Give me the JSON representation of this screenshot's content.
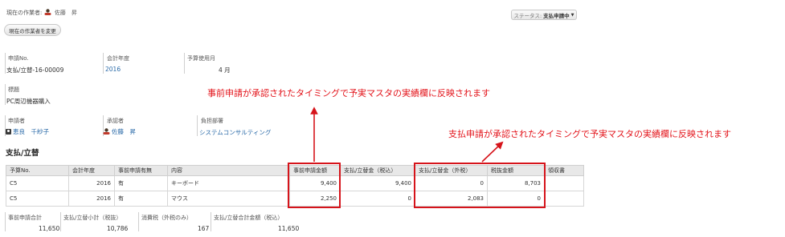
{
  "header": {
    "current_worker_label": "現在の作業者:",
    "current_worker_name": "佐藤　昇",
    "change_worker_button": "現在の作業者を変更",
    "status_label": "ステータス:",
    "status_value": "支払申請中",
    "status_dropdown_icon": "chevron-down-icon"
  },
  "fields": {
    "application_no_label": "申請No.",
    "application_no_value": "支払/立替-16-00009",
    "fiscal_year_label": "会計年度",
    "fiscal_year_value": "2016",
    "budget_month_label": "予算使用月",
    "budget_month_value": "4 月",
    "subject_label": "標題",
    "subject_value": "PC周辺機器購入",
    "applicant_label": "申請者",
    "applicant_value": "恵良　千紗子",
    "approver_label": "承認者",
    "approver_value": "佐藤　昇",
    "department_label": "負担部署",
    "department_value": "システムコンサルティング"
  },
  "section": {
    "title": "支払/立替"
  },
  "table": {
    "headers": [
      "予算No.",
      "会計年度",
      "事前申請有無",
      "内容",
      "事前申請金額",
      "支払/立替金（税込）",
      "支払/立替金（外税）",
      "税抜金額",
      "領収書"
    ],
    "rows": [
      [
        "C5",
        "2016",
        "有",
        "キーボード",
        "9,400",
        "9,400",
        "0",
        "8,703",
        ""
      ],
      [
        "C5",
        "2016",
        "有",
        "マウス",
        "2,250",
        "0",
        "2,083",
        "0",
        ""
      ]
    ]
  },
  "totals": {
    "pre_total_label": "事前申請合計",
    "pre_total_value": "11,650",
    "subtotal_label": "支払/立替小計（税抜）",
    "subtotal_value": "10,786",
    "tax_label": "消費税（外税のみ）",
    "tax_value": "167",
    "grand_total_label": "支払/立替合計金額（税込）",
    "grand_total_value": "11,650"
  },
  "annotations": {
    "pre_application": "事前申請が承認されたタイミングで予実マスタの実績欄に反映されます",
    "payment_application": "支払申請が承認されたタイミングで予実マスタの実績欄に反映されます",
    "color": "#e3141b"
  },
  "colors": {
    "link": "#2a6aa8",
    "highlight_box": "#d6141b",
    "table_header_bg": "#e8e8e8"
  }
}
